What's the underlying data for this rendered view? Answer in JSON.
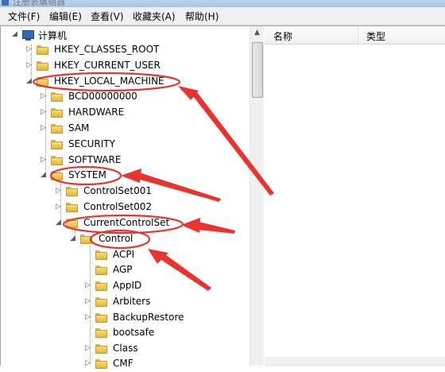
{
  "title": {
    "text": "注册表编辑器"
  },
  "menu": [
    {
      "label": "文件(F)"
    },
    {
      "label": "编辑(E)"
    },
    {
      "label": "查看(V)"
    },
    {
      "label": "收藏夹(A)"
    },
    {
      "label": "帮助(H)"
    }
  ],
  "tree": {
    "root": "计算机",
    "hkcr": "HKEY_CLASSES_ROOT",
    "hkcu": "HKEY_CURRENT_USER",
    "hklm": "HKEY_LOCAL_MACHINE",
    "bcd": "BCD00000000",
    "hardware": "HARDWARE",
    "sam": "SAM",
    "security": "SECURITY",
    "software": "SOFTWARE",
    "system": "SYSTEM",
    "cs001": "ControlSet001",
    "cs002": "ControlSet002",
    "ccs": "CurrentControlSet",
    "control": "Control",
    "acpi": "ACPI",
    "agp": "AGP",
    "appid": "AppID",
    "arbiters": "Arbiters",
    "backuprestore": "BackupRestore",
    "bootsafe": "bootsafe",
    "class": "Class",
    "cmf": "CMF"
  },
  "columns": {
    "name": "名称",
    "type": "类型"
  },
  "annotation": {
    "color": "#e8332e"
  },
  "icons": {
    "expanded": "◢",
    "collapsed": "▷",
    "scroll_up": "▲"
  }
}
